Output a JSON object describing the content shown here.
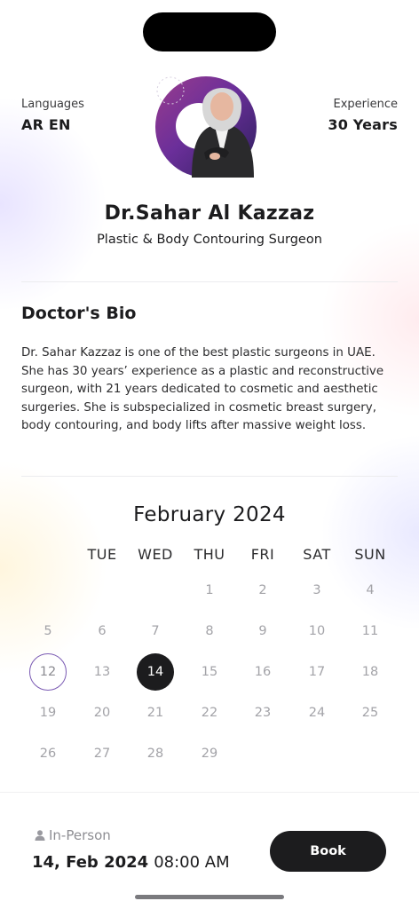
{
  "profile": {
    "languages_label": "Languages",
    "languages_value": "AR EN",
    "experience_label": "Experience",
    "experience_value": "30 Years",
    "name": "Dr.Sahar Al Kazzaz",
    "specialty": "Plastic & Body Contouring Surgeon"
  },
  "bio": {
    "heading": "Doctor's Bio",
    "text": "Dr. Sahar Kazzaz is one of the best plastic surgeons in UAE. She has 30 years’ experience as a plastic and reconstructive surgeon, with 21 years dedicated to cosmetic and aesthetic surgeries. She is subspecialized in cosmetic breast surgery, body contouring, and body lifts after massive weight loss."
  },
  "calendar": {
    "month_title": "February 2024",
    "weekdays": [
      "TUE",
      "WED",
      "THU",
      "FRI",
      "SAT",
      "SUN"
    ],
    "weeks": [
      [
        "",
        "",
        "1",
        "2",
        "3",
        "4"
      ],
      [
        "5",
        "6",
        "7",
        "8",
        "9",
        "10",
        "11"
      ],
      [
        "12",
        "13",
        "14",
        "15",
        "16",
        "17",
        "18"
      ],
      [
        "19",
        "20",
        "21",
        "22",
        "23",
        "24",
        "25"
      ],
      [
        "26",
        "27",
        "28",
        "29",
        "",
        "",
        ""
      ]
    ],
    "selected_day": "14",
    "today_day": "12",
    "accent_color": "#7a5ab3"
  },
  "booking": {
    "mode_icon": "person-icon",
    "mode": "In-Person",
    "date": "14, Feb 2024",
    "time": "08:00 AM",
    "book_label": "Book"
  }
}
